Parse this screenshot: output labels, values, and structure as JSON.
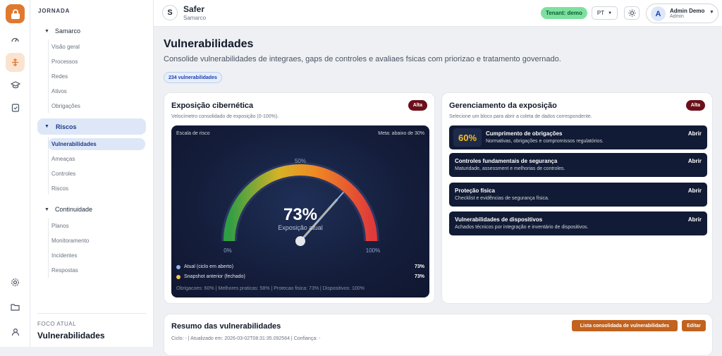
{
  "app": {
    "initial": "S",
    "name": "Safer",
    "org": "Samarco"
  },
  "header": {
    "tenant": "Tenant: demo",
    "lang": "PT",
    "user_initial": "A",
    "user_name": "Admin Demo",
    "user_role": "Admin"
  },
  "sidebar": {
    "section": "JORNADA",
    "groups": [
      {
        "label": "Samarco",
        "items": [
          "Visão geral",
          "Processos",
          "Redes",
          "Ativos",
          "Obrigações"
        ]
      },
      {
        "label": "Riscos",
        "items": [
          "Vulnerabilidades",
          "Ameaças",
          "Controles",
          "Riscos"
        ]
      },
      {
        "label": "Continuidade",
        "items": [
          "Planos",
          "Monitoramento",
          "Incidentes",
          "Respostas"
        ]
      }
    ],
    "focus_label": "FOCO ATUAL",
    "focus_value": "Vulnerabilidades"
  },
  "page": {
    "title": "Vulnerabilidades",
    "subtitle": "Consolide vulnerabilidades de integraes, gaps de controles e avaliaes fsicas com priorizao e tratamento governado.",
    "count_badge": "234 vulnerabilidades"
  },
  "exposure": {
    "title": "Exposição cibernética",
    "subtitle": "Velocímetro consolidado de exposição (0-100%).",
    "badge": "Alta",
    "scale_label": "Escala de risco",
    "target": "Meta: abaixo de 30%",
    "value": 73,
    "value_text": "73%",
    "value_label": "Exposição atual",
    "tick_min": "0%",
    "tick_mid": "50%",
    "tick_max": "100%",
    "legend": [
      {
        "label": "Atual (ciclo em aberto)",
        "value": "73%",
        "color": "#8fb4f0"
      },
      {
        "label": "Snapshot anterior (fechado)",
        "value": "73%",
        "color": "#f5c451"
      }
    ],
    "footer": "Obrigacoes: 60% | Melhores praticas: 58% | Protecao fisica: 73% | Dispositivos: 100%"
  },
  "management": {
    "title": "Gerenciamento da exposição",
    "subtitle": "Selecione um bloco para abrir a coleta de dados correspondente.",
    "badge": "Alta",
    "blocks": [
      {
        "pct": "60%",
        "title": "Cumprimento de obrigações",
        "desc": "Normativas, obrigações e compromissos regulatórios.",
        "action": "Abrir"
      },
      {
        "title": "Controles fundamentais de segurança",
        "desc": "Maturidade, assessment e melhorias de controles.",
        "action": "Abrir"
      },
      {
        "title": "Proteção física",
        "desc": "Checklist e evidências de segurança física.",
        "action": "Abrir"
      },
      {
        "title": "Vulnerabilidades de dispositivos",
        "desc": "Achados técnicos por integração e inventário de dispositivos.",
        "action": "Abrir"
      }
    ]
  },
  "summary": {
    "title": "Resumo das vulnerabilidades",
    "meta": "Ciclo: - | Atualizado em: 2026-03-02T08:31:35.092564 | Confiança: -",
    "list_button": "Lista consolidada de vulnerabilidades",
    "edit_button": "Editar"
  }
}
